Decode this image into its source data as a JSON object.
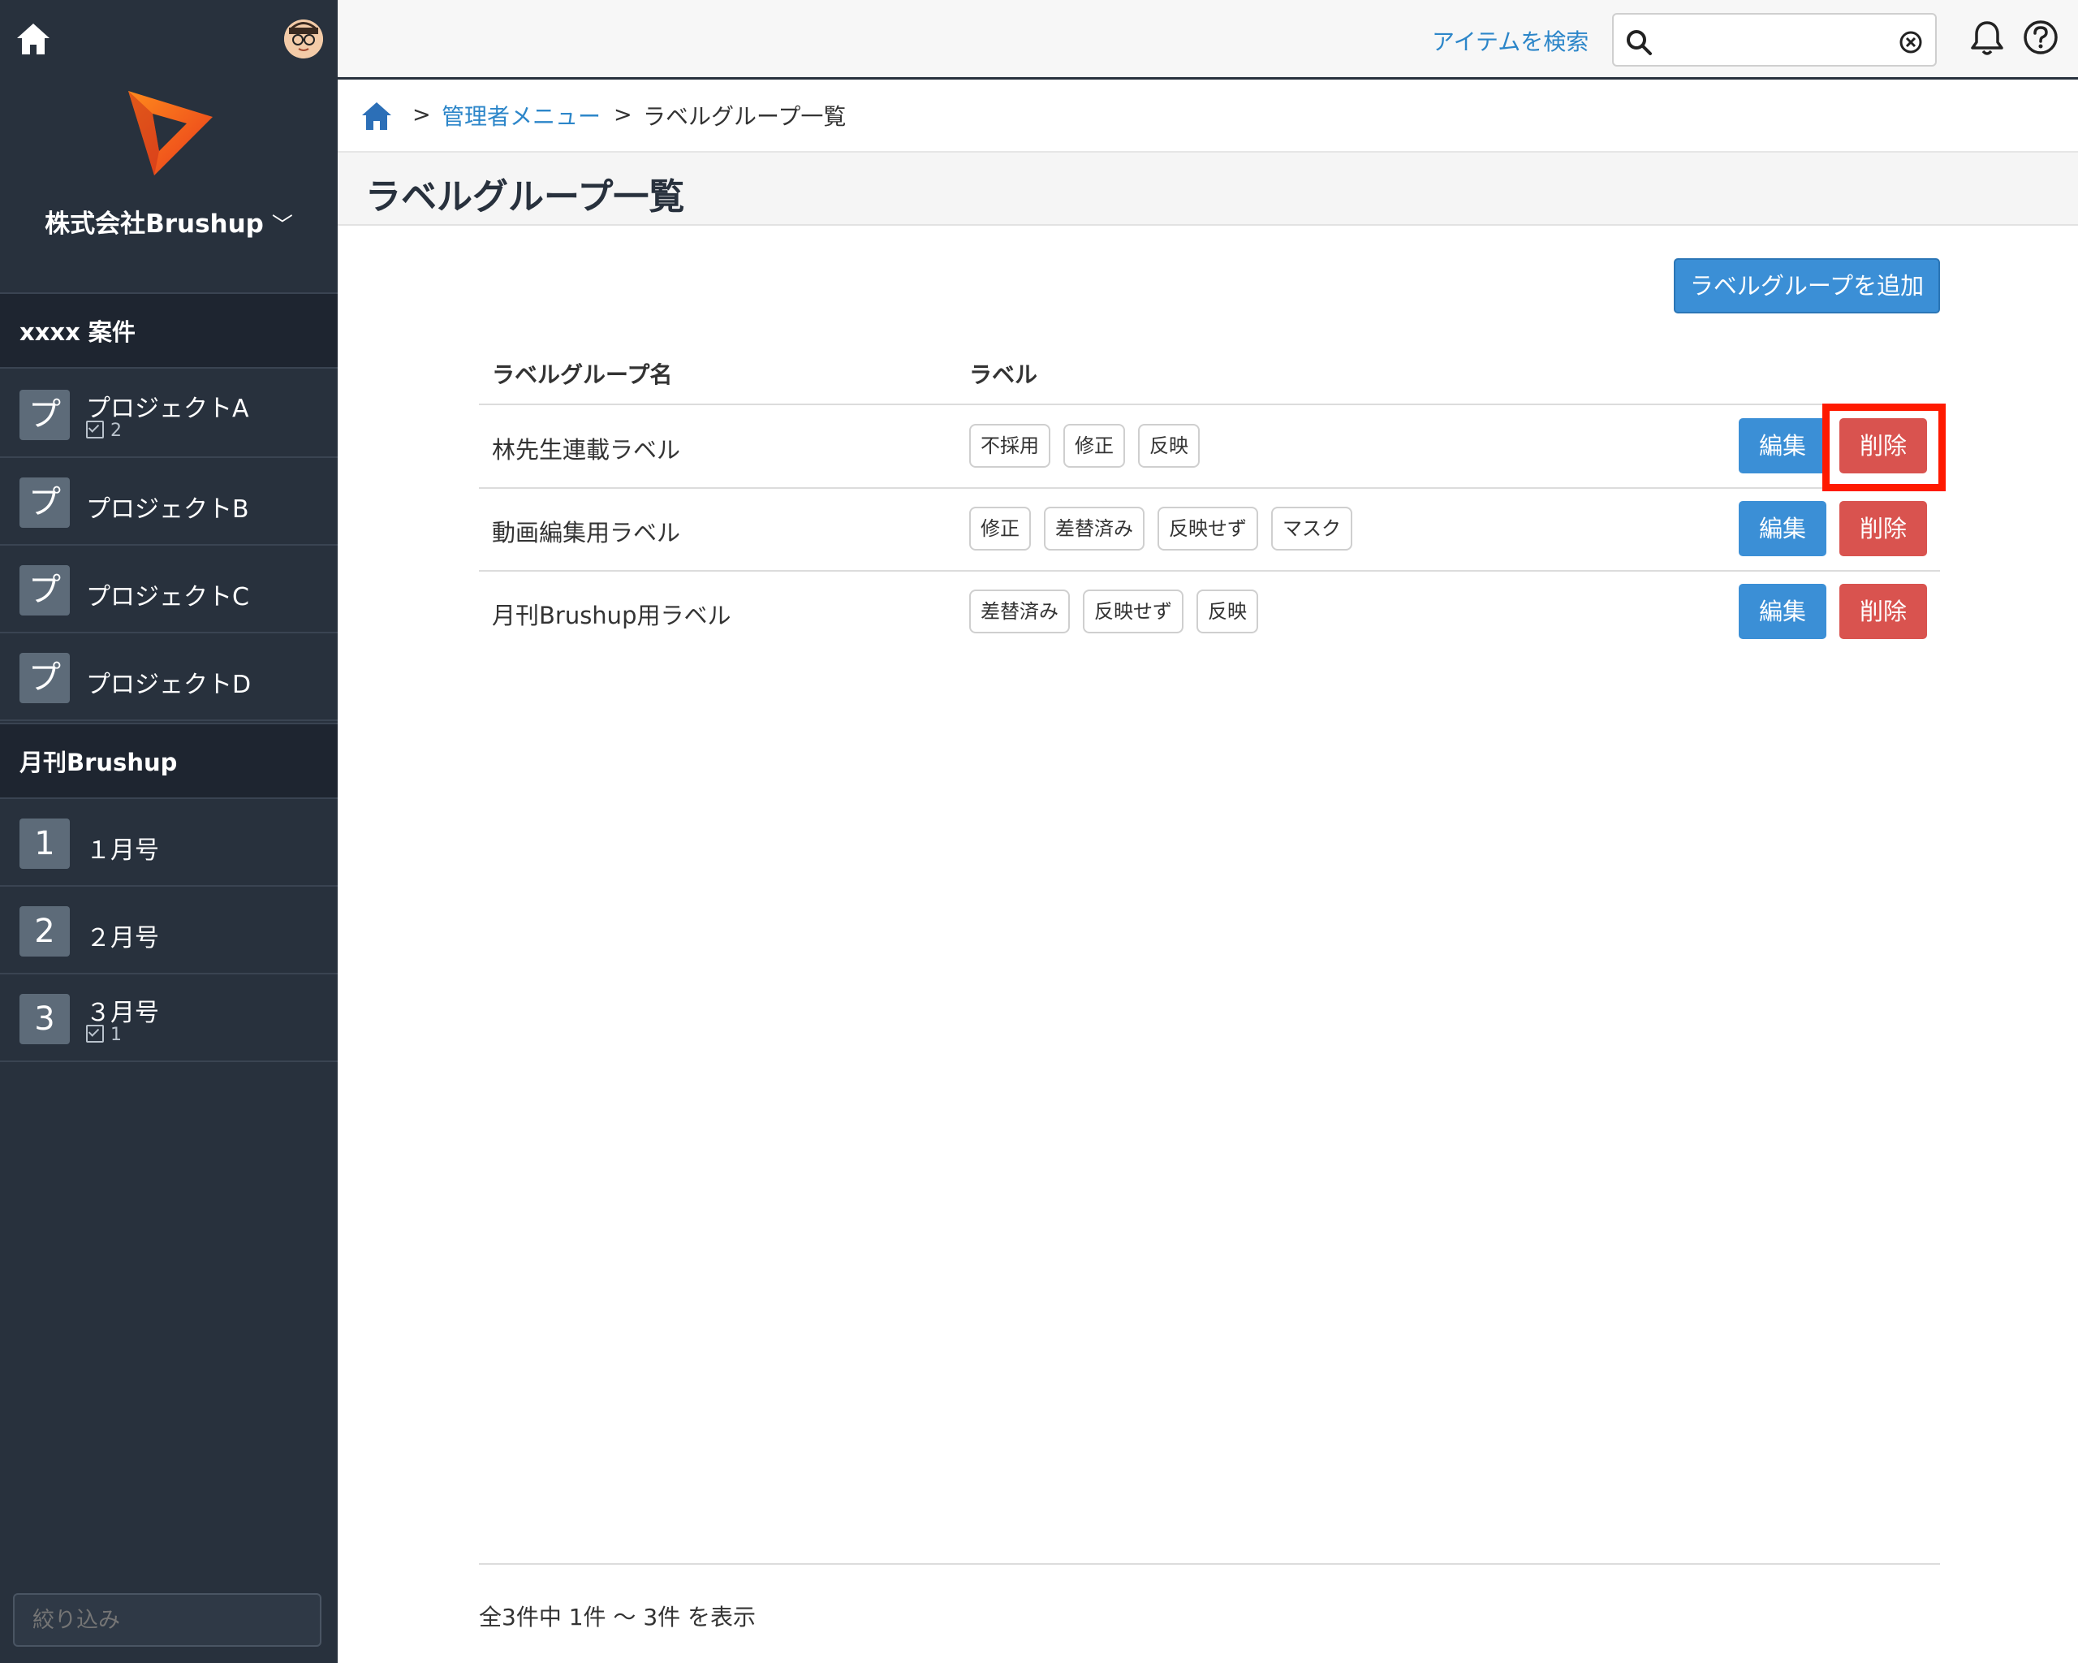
{
  "sidebar": {
    "company": "株式会社Brushup",
    "groups": [
      {
        "title": "xxxx 案件",
        "items": [
          {
            "icon_char": "プ",
            "name": "プロジェクトA",
            "count": "2"
          },
          {
            "icon_char": "プ",
            "name": "プロジェクトB",
            "count": ""
          },
          {
            "icon_char": "プ",
            "name": "プロジェクトC",
            "count": ""
          },
          {
            "icon_char": "プ",
            "name": "プロジェクトD",
            "count": ""
          }
        ]
      },
      {
        "title": "月刊Brushup",
        "items": [
          {
            "icon_char": "1",
            "name": "１月号",
            "count": ""
          },
          {
            "icon_char": "2",
            "name": "２月号",
            "count": ""
          },
          {
            "icon_char": "3",
            "name": "３月号",
            "count": "1"
          }
        ]
      }
    ],
    "filter_placeholder": "絞り込み"
  },
  "topbar": {
    "search_link": "アイテムを検索",
    "search_value": ""
  },
  "breadcrumb": {
    "parent": "管理者メニュー",
    "current": "ラベルグループ一覧",
    "separator": ">"
  },
  "page": {
    "title": "ラベルグループ一覧",
    "add_button": "ラベルグループを追加"
  },
  "table": {
    "headers": {
      "name": "ラベルグループ名",
      "labels": "ラベル"
    },
    "rows": [
      {
        "name": "林先生連載ラベル",
        "labels": [
          "不採用",
          "修正",
          "反映"
        ]
      },
      {
        "name": "動画編集用ラベル",
        "labels": [
          "修正",
          "差替済み",
          "反映せず",
          "マスク"
        ]
      },
      {
        "name": "月刊Brushup用ラベル",
        "labels": [
          "差替済み",
          "反映せず",
          "反映"
        ]
      }
    ],
    "edit_label": "編集",
    "delete_label": "削除"
  },
  "footer": {
    "summary": "全3件中 1件 〜 3件 を表示"
  },
  "colors": {
    "sidebar_bg": "#28313d",
    "accent_blue": "#3b8fd6",
    "delete_red": "#d9534f",
    "highlight": "#ff1a00"
  }
}
